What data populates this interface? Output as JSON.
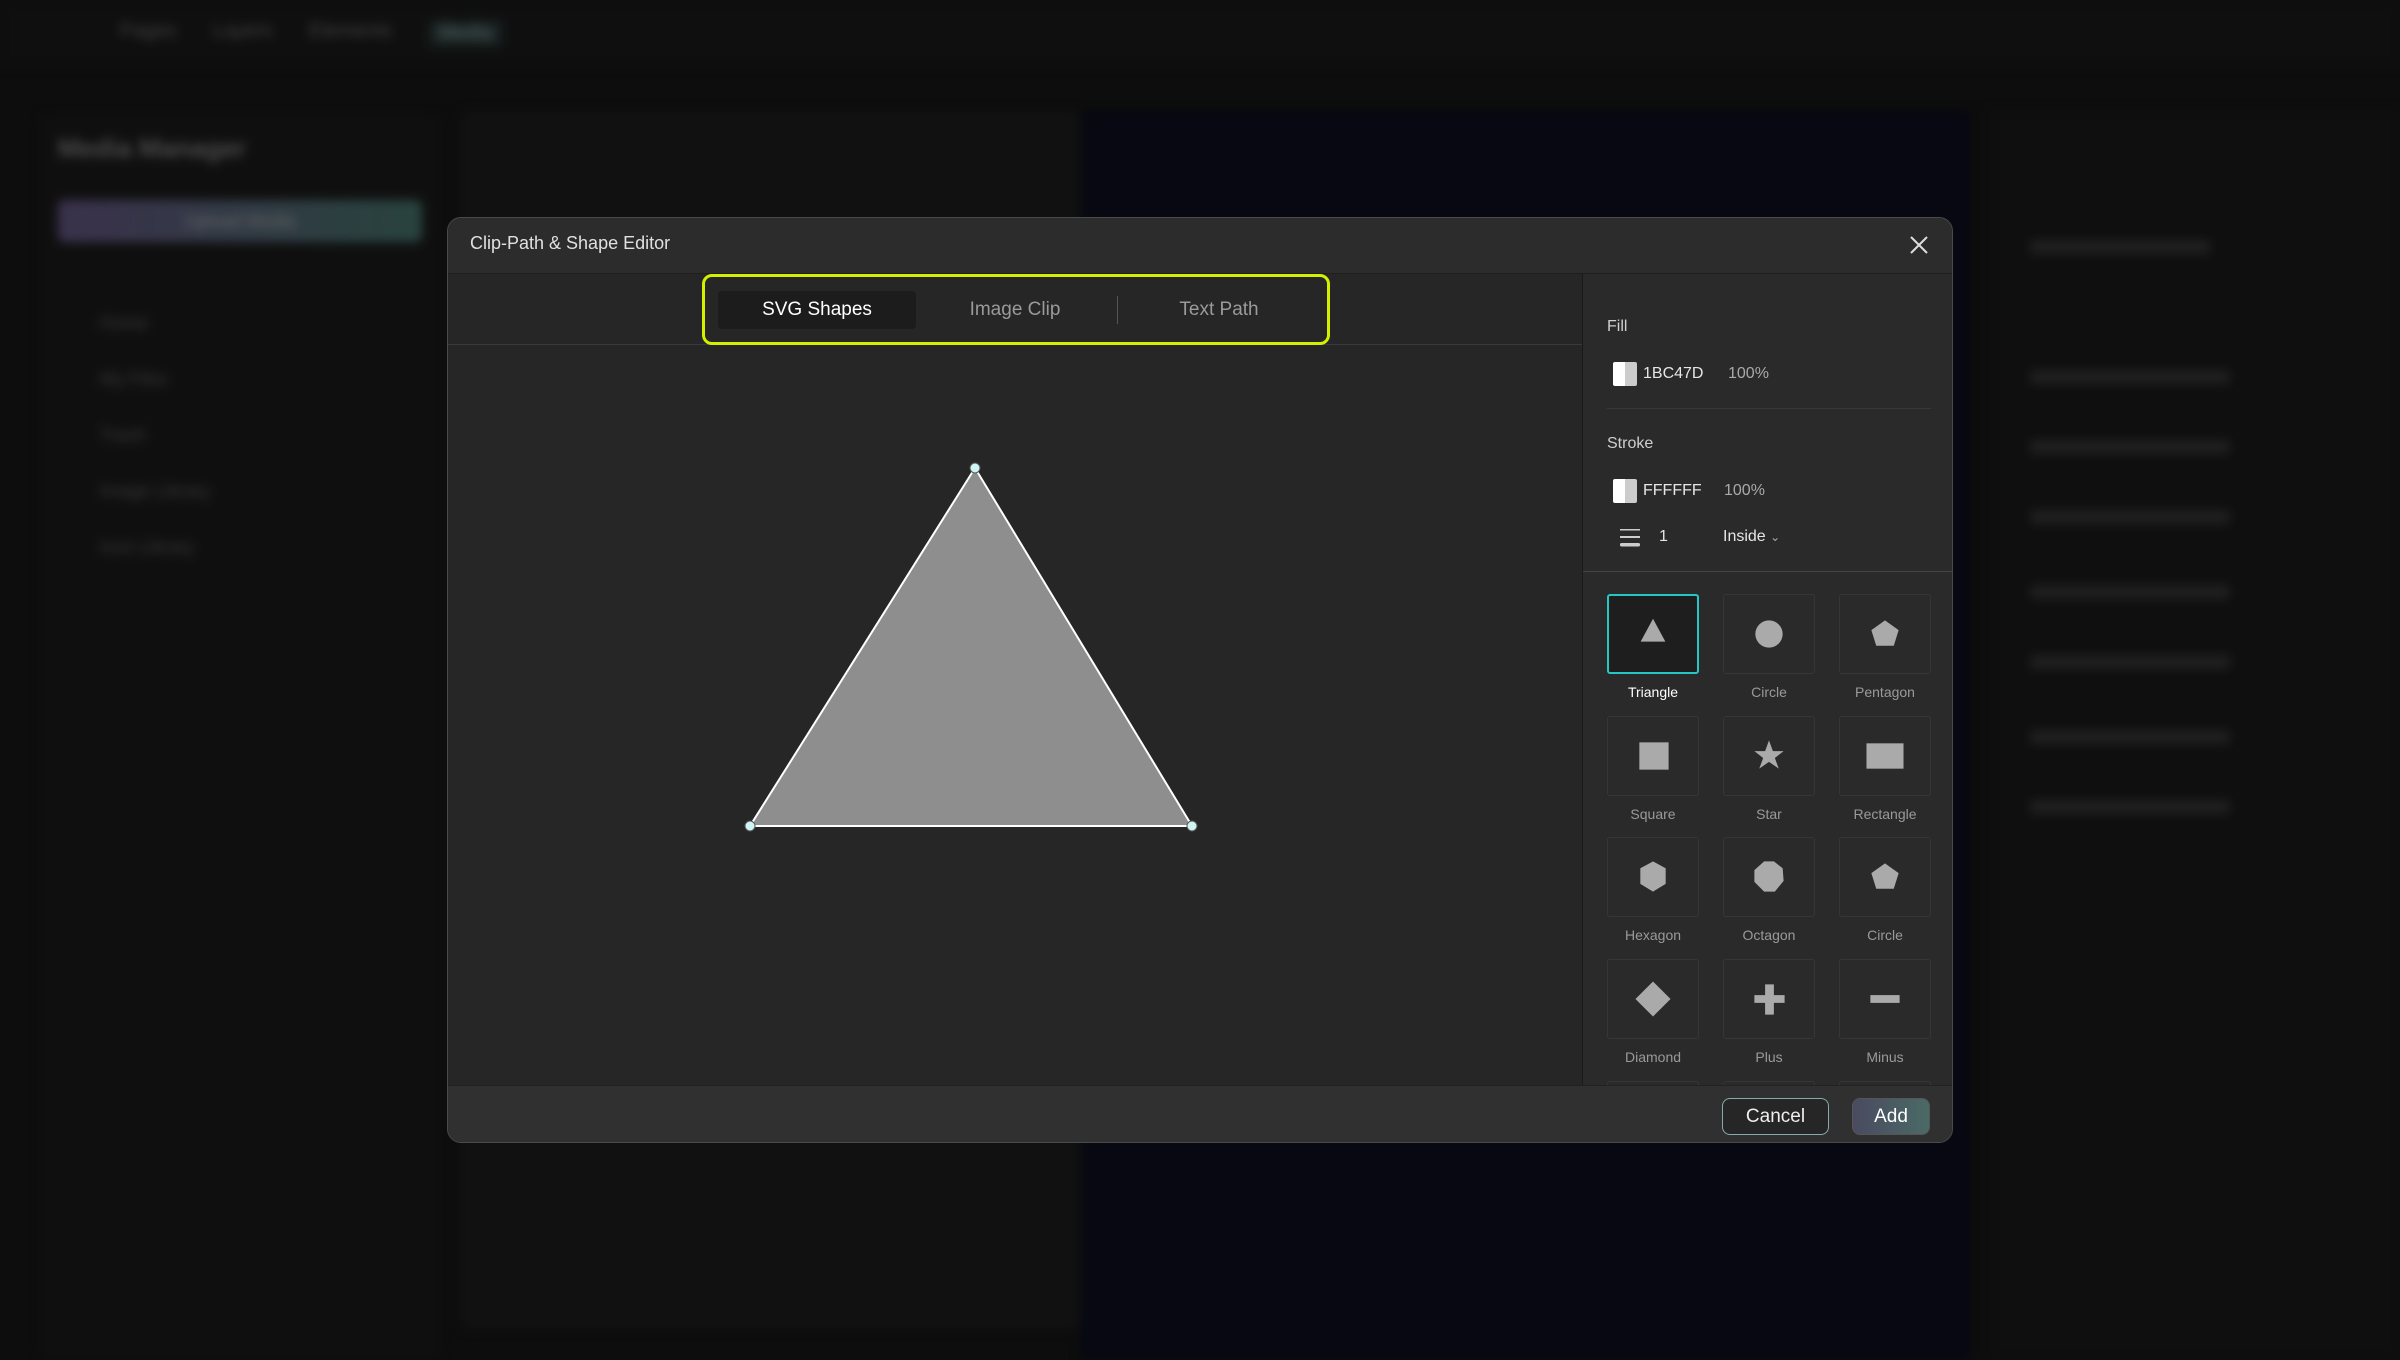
{
  "background": {
    "top_nav": [
      "Pages",
      "Layers",
      "Elements",
      "Media"
    ],
    "media_manager": {
      "title": "Media Manager",
      "upload_label": "Upload Media",
      "items": [
        "Home",
        "My Files",
        "Trash",
        "Image Library",
        "Icon Library"
      ]
    }
  },
  "dialog": {
    "title": "Clip-Path & Shape Editor",
    "close_icon": "close-icon",
    "tabs": [
      {
        "label": "SVG Shapes",
        "active": true
      },
      {
        "label": "Image Clip",
        "active": false
      },
      {
        "label": "Text Path",
        "active": false
      }
    ],
    "highlight_color": "#D4F000",
    "canvas": {
      "shape": "Triangle",
      "fill_color": "#8E8E8E",
      "stroke_color": "#FFFFFF",
      "handle_color": "#CFF4F4"
    },
    "fill": {
      "label": "Fill",
      "hex": "1BC47D",
      "opacity": "100%"
    },
    "stroke": {
      "label": "Stroke",
      "hex": "FFFFFF",
      "opacity": "100%",
      "width": "1",
      "position": "Inside",
      "width_icon": "stroke-weight-icon"
    },
    "shapes": [
      {
        "label": "Triangle",
        "selected": true
      },
      {
        "label": "Circle"
      },
      {
        "label": "Pentagon"
      },
      {
        "label": "Square"
      },
      {
        "label": "Star"
      },
      {
        "label": "Rectangle"
      },
      {
        "label": "Hexagon"
      },
      {
        "label": "Octagon"
      },
      {
        "label": "Circle"
      },
      {
        "label": "Diamond"
      },
      {
        "label": "Plus"
      },
      {
        "label": "Minus"
      }
    ],
    "selected_color": "#26C6C6",
    "buttons": {
      "cancel": "Cancel",
      "add": "Add"
    }
  }
}
